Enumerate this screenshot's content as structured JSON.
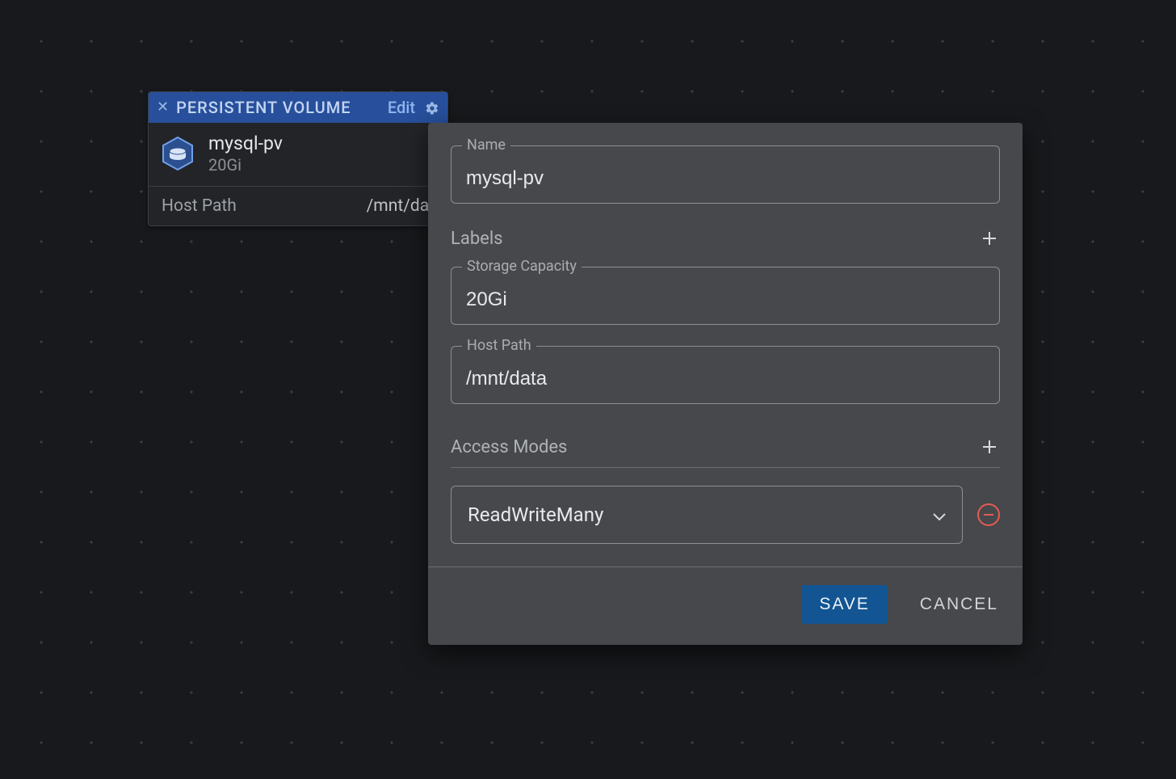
{
  "card": {
    "title": "PERSISTENT VOLUME",
    "edit_label": "Edit",
    "name": "mysql-pv",
    "size": "20Gi",
    "footer_label": "Host Path",
    "footer_value": "/mnt/dat"
  },
  "panel": {
    "fields": {
      "name": {
        "label": "Name",
        "value": "mysql-pv"
      },
      "storage": {
        "label": "Storage Capacity",
        "value": "20Gi"
      },
      "hostpath": {
        "label": "Host Path",
        "value": "/mnt/data"
      }
    },
    "labels_heading": "Labels",
    "access_modes_heading": "Access Modes",
    "access_modes": [
      {
        "value": "ReadWriteMany"
      }
    ],
    "buttons": {
      "save": "SAVE",
      "cancel": "CANCEL"
    }
  }
}
